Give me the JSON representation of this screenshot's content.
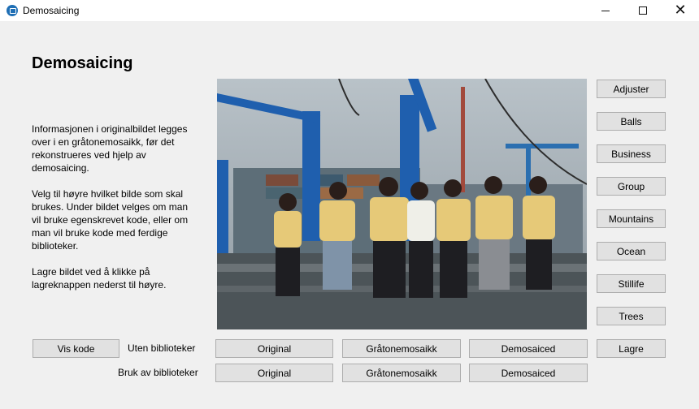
{
  "window": {
    "title": "Demosaicing"
  },
  "heading": "Demosaicing",
  "info": {
    "p1": "Informasjonen i originalbildet legges over i en gråtonemosaikk, før det rekonstrueres ved hjelp av demosaicing.",
    "p2": "Velg til høyre hvilket bilde som skal brukes. Under bildet velges om man vil bruke egenskrevet kode, eller om man vil bruke kode med ferdige biblioteker.",
    "p3": "Lagre bildet ved å klikke på lagreknappen nederst til høyre."
  },
  "images": [
    "Adjuster",
    "Balls",
    "Business",
    "Group",
    "Mountains",
    "Ocean",
    "Stillife",
    "Trees"
  ],
  "rows": {
    "without_lib": {
      "label": "Uten biblioteker",
      "original": "Original",
      "gray": "Gråtonemosaikk",
      "demosaiced": "Demosaiced"
    },
    "with_lib": {
      "label": "Bruk av biblioteker",
      "original": "Original",
      "gray": "Gråtonemosaikk",
      "demosaiced": "Demosaiced"
    }
  },
  "vis_kode": "Vis kode",
  "lagre": "Lagre",
  "colors": {
    "window_bg": "#f0f0f0",
    "button_bg": "#e1e1e1",
    "button_border": "#adadad",
    "app_icon": "#1f6fb5"
  }
}
